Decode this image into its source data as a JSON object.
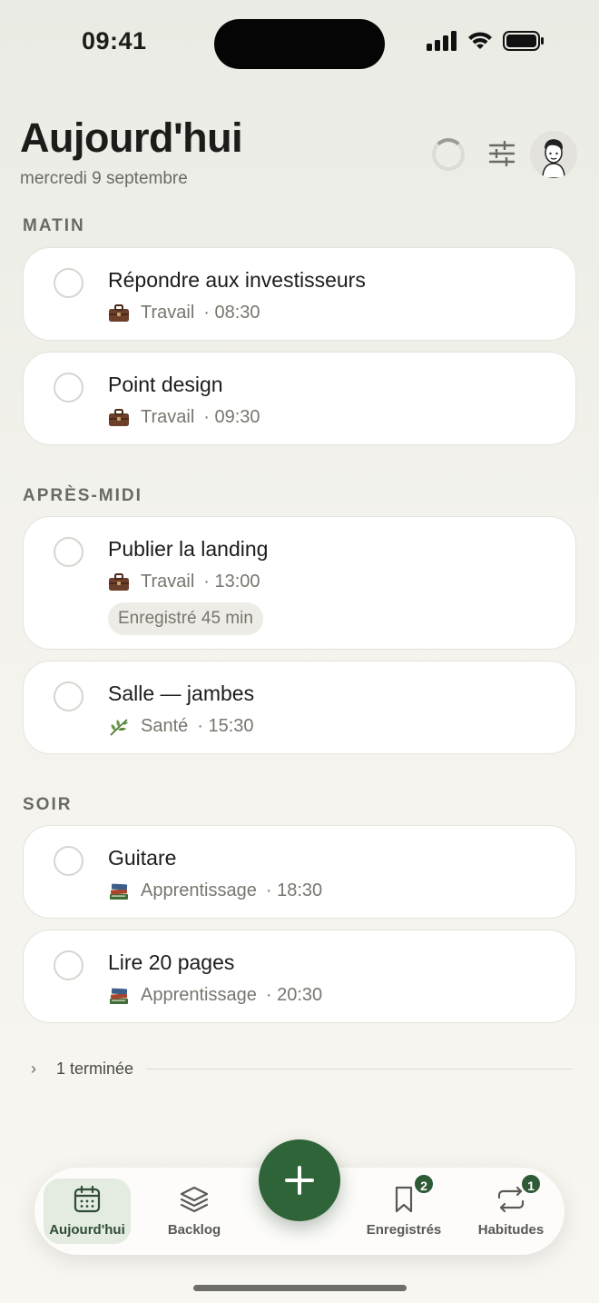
{
  "status_bar": {
    "time": "09:41"
  },
  "header": {
    "title": "Aujourd'hui",
    "date": "mercredi 9 septembre"
  },
  "sections": [
    {
      "label": "MATIN",
      "tasks": [
        {
          "title": "Répondre aux investisseurs",
          "category": "Travail",
          "time": "· 08:30",
          "icon": "briefcase-emoji"
        },
        {
          "title": "Point design",
          "category": "Travail",
          "time": "· 09:30",
          "icon": "briefcase-emoji"
        }
      ]
    },
    {
      "label": "APRÈS-MIDI",
      "tasks": [
        {
          "title": "Publier la landing",
          "category": "Travail",
          "time": "· 13:00",
          "icon": "briefcase-emoji",
          "logged": "Enregistré 45 min"
        },
        {
          "title": "Salle — jambes",
          "category": "Santé",
          "time": "· 15:30",
          "icon": "herb-emoji"
        }
      ]
    },
    {
      "label": "SOIR",
      "tasks": [
        {
          "title": "Guitare",
          "category": "Apprentissage",
          "time": "· 18:30",
          "icon": "books-emoji"
        },
        {
          "title": "Lire 20 pages",
          "category": "Apprentissage",
          "time": "· 20:30",
          "icon": "books-emoji"
        }
      ]
    }
  ],
  "completed": {
    "chevron": "›",
    "label": "1 terminée"
  },
  "tabbar": {
    "tabs": [
      {
        "label": "Aujourd'hui",
        "icon": "calendar-icon",
        "active": true
      },
      {
        "label": "Backlog",
        "icon": "layers-icon"
      },
      {
        "label": "Enregistrés",
        "icon": "bookmark-icon",
        "badge": "2"
      },
      {
        "label": "Habitudes",
        "icon": "repeat-icon",
        "badge": "1"
      }
    ],
    "fab_icon": "plus-icon"
  },
  "colors": {
    "accent": "#2f6338",
    "background": "#f3f2ec",
    "card": "#ffffff"
  }
}
